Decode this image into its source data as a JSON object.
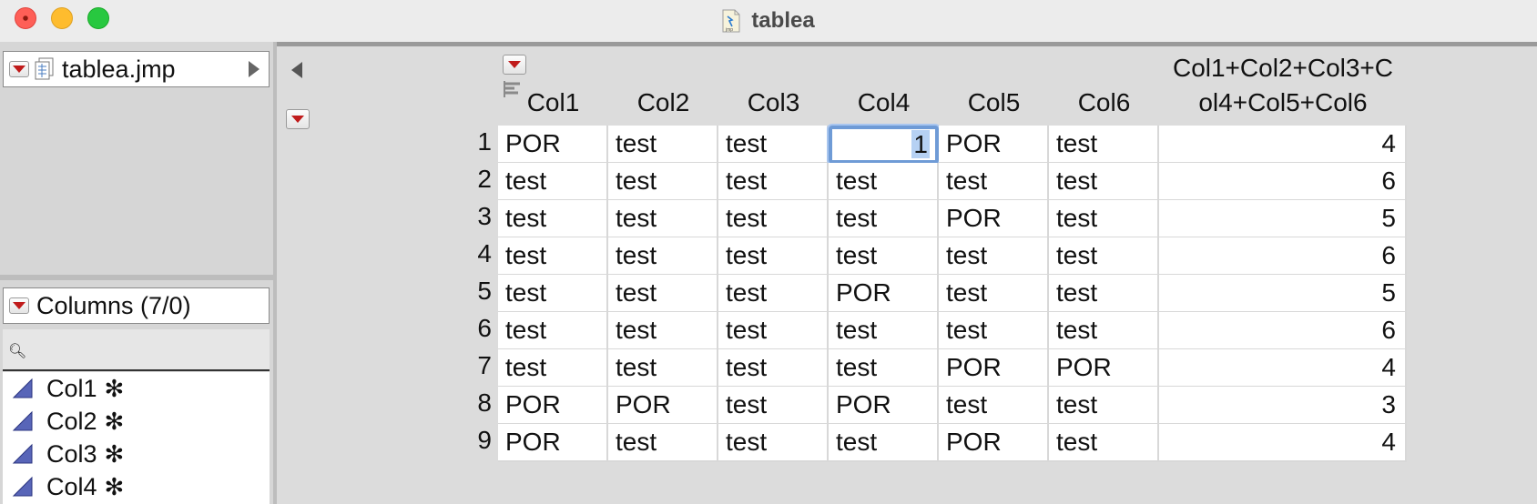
{
  "window": {
    "title": "tablea"
  },
  "left_panel": {
    "table_name": "tablea.jmp",
    "columns_title": "Columns (7/0)",
    "columns": [
      {
        "name": "Col1",
        "marker": "✻"
      },
      {
        "name": "Col2",
        "marker": "✻"
      },
      {
        "name": "Col3",
        "marker": "✻"
      },
      {
        "name": "Col4",
        "marker": "✻"
      }
    ]
  },
  "grid": {
    "headers": [
      "Col1",
      "Col2",
      "Col3",
      "Col4",
      "Col5",
      "Col6",
      "Col1+Col2+Col3+Col4+Col5+Col6"
    ],
    "header_lines": [
      "Col1+Col2+Col3+C",
      "ol4+Col5+Col6"
    ],
    "rows": [
      {
        "n": "1",
        "cells": [
          "POR",
          "test",
          "test",
          "1",
          "POR",
          "test",
          "4"
        ]
      },
      {
        "n": "2",
        "cells": [
          "test",
          "test",
          "test",
          "test",
          "test",
          "test",
          "6"
        ]
      },
      {
        "n": "3",
        "cells": [
          "test",
          "test",
          "test",
          "test",
          "POR",
          "test",
          "5"
        ]
      },
      {
        "n": "4",
        "cells": [
          "test",
          "test",
          "test",
          "test",
          "test",
          "test",
          "6"
        ]
      },
      {
        "n": "5",
        "cells": [
          "test",
          "test",
          "test",
          "POR",
          "test",
          "test",
          "5"
        ]
      },
      {
        "n": "6",
        "cells": [
          "test",
          "test",
          "test",
          "test",
          "test",
          "test",
          "6"
        ]
      },
      {
        "n": "7",
        "cells": [
          "test",
          "test",
          "test",
          "test",
          "POR",
          "POR",
          "4"
        ]
      },
      {
        "n": "8",
        "cells": [
          "POR",
          "POR",
          "test",
          "POR",
          "test",
          "test",
          "3"
        ]
      },
      {
        "n": "9",
        "cells": [
          "POR",
          "test",
          "test",
          "test",
          "POR",
          "test",
          "4"
        ]
      }
    ],
    "selected_cell": {
      "row": 1,
      "col": 4
    }
  },
  "colors": {
    "accent": "#6f9bd6",
    "menu_triangle": "#c01b1b"
  }
}
